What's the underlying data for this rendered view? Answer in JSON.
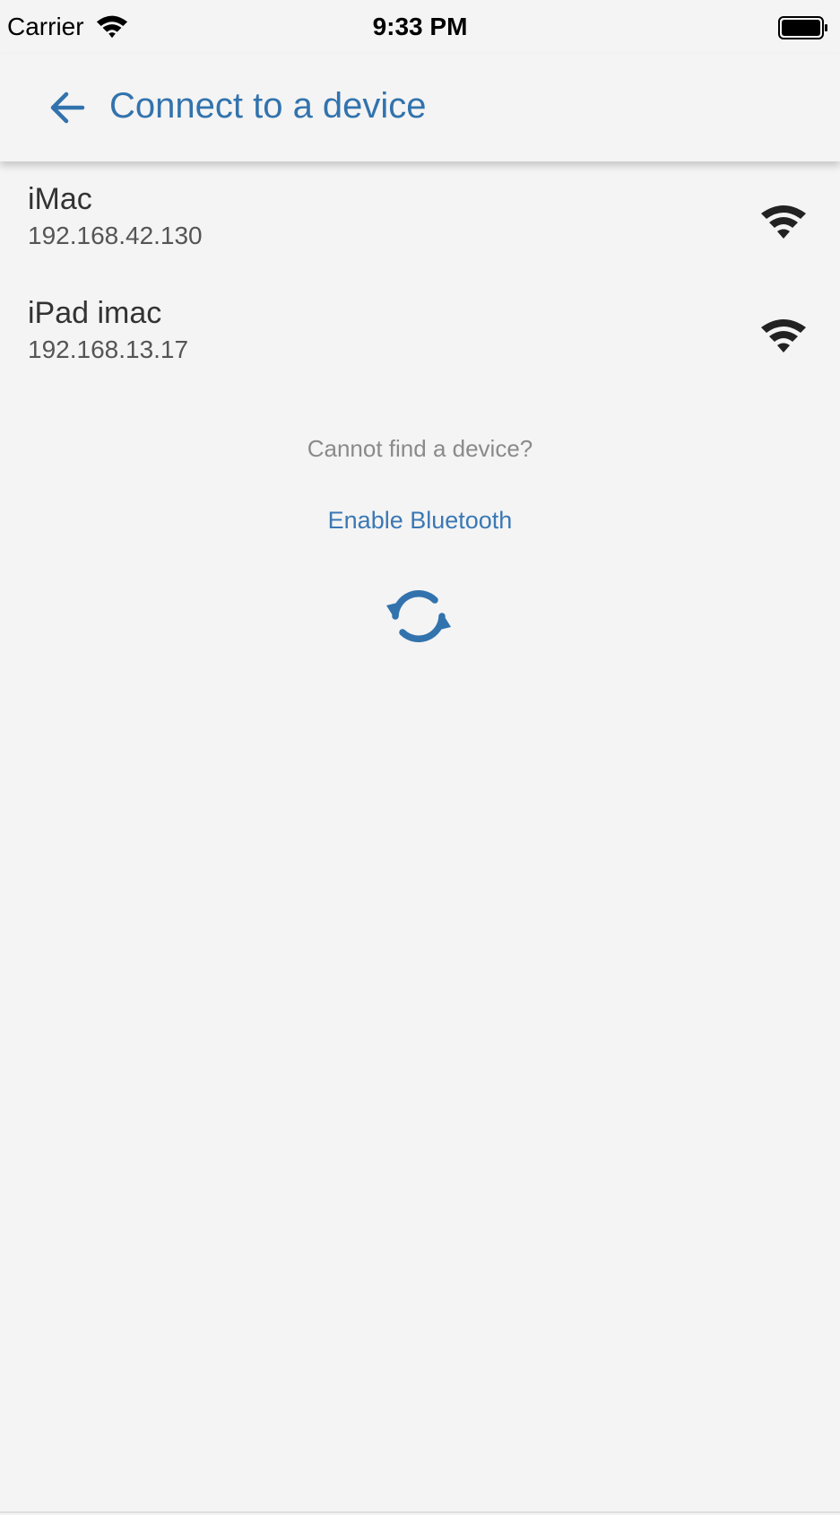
{
  "status_bar": {
    "carrier": "Carrier",
    "time": "9:33 PM",
    "icons": [
      "wifi-icon",
      "battery-icon"
    ]
  },
  "header": {
    "back_icon": "arrow-left-icon",
    "title": "Connect to a device"
  },
  "devices": [
    {
      "name": "iMac",
      "ip": "192.168.42.130",
      "icon": "wifi-icon"
    },
    {
      "name": "iPad imac",
      "ip": "192.168.13.17",
      "icon": "wifi-icon"
    }
  ],
  "help": {
    "cannot_find": "Cannot find a device?",
    "enable_bluetooth": "Enable Bluetooth",
    "refresh_icon": "refresh-icon"
  },
  "colors": {
    "accent": "#3273ad",
    "background": "#f4f4f4",
    "device_icon": "#222222",
    "muted_text": "#8a8a8a"
  }
}
